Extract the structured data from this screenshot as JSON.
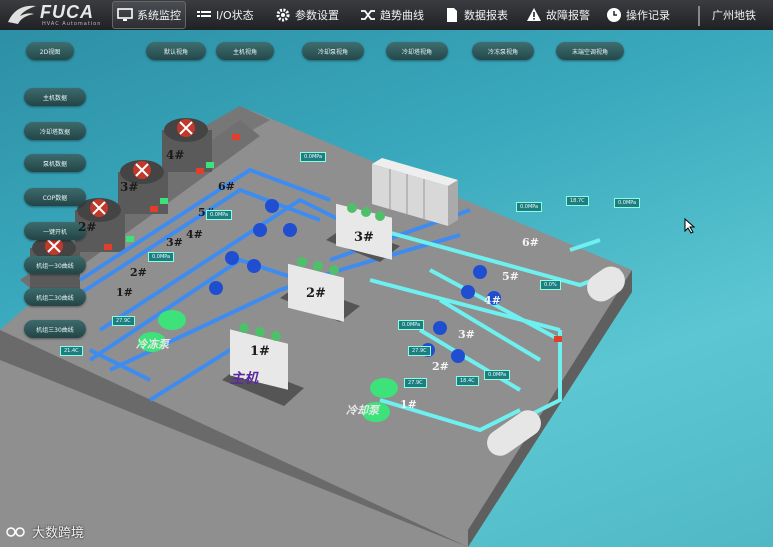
{
  "logo": {
    "name": "FUCA",
    "subtitle": "HVAC Automation"
  },
  "nav": [
    {
      "label": "系统监控",
      "icon": "monitor-icon"
    },
    {
      "label": "I/O状态",
      "icon": "io-list-icon"
    },
    {
      "label": "参数设置",
      "icon": "gear-icon"
    },
    {
      "label": "趋势曲线",
      "icon": "shuffle-icon"
    },
    {
      "label": "数据报表",
      "icon": "document-icon"
    },
    {
      "label": "故障报警",
      "icon": "warning-icon"
    },
    {
      "label": "操作记录",
      "icon": "clock-icon"
    }
  ],
  "location": "广州地铁",
  "view_buttons": [
    "2D视图",
    "默认视角",
    "主机视角",
    "冷却泵视角",
    "冷却塔视角",
    "冷冻泵视角",
    "末端空调视角"
  ],
  "side_buttons": [
    "主机数据",
    "冷却塔数据",
    "泵机数据",
    "COP数据",
    "一键开机",
    "机组一30曲线",
    "机组二30曲线",
    "机组三30曲线"
  ],
  "towers": [
    "1#",
    "2#",
    "3#",
    "4#"
  ],
  "chillers": [
    "1#",
    "2#",
    "3#"
  ],
  "cooling_pumps": [
    "1#",
    "2#",
    "3#",
    "4#",
    "5#",
    "6#"
  ],
  "chilled_pumps": [
    "1#",
    "2#",
    "3#",
    "4#",
    "5#",
    "6#"
  ],
  "labels": {
    "main_unit": "主机",
    "chilled_pump": "冷冻泵",
    "cooling_pump": "冷却泵"
  },
  "tags": [
    "0.0MPa",
    "0.0MPa",
    "0.0MPa",
    "27.9C",
    "0.0MPa",
    "27.9C",
    "27.9C",
    "18.4C",
    "0.0MPa",
    "18.7C",
    "0.0MPa",
    "0.0%",
    "21.4C",
    "0.0MPa"
  ],
  "watermark": "大数跨境",
  "colors": {
    "pipe_blue": "#3f8cf0",
    "pipe_cyan": "#6ff0f0",
    "pump_green": "#3ee27a",
    "floor": "#8d8d8d"
  }
}
